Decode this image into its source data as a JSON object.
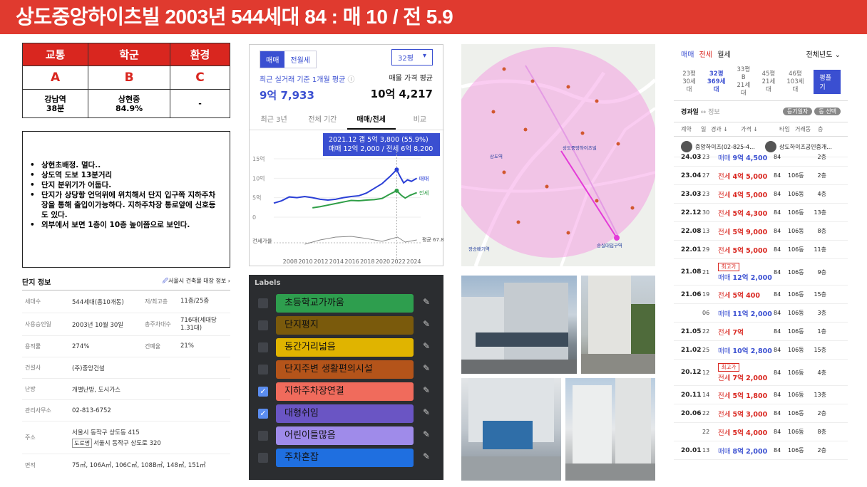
{
  "title": "상도중앙하이츠빌   2003년 544세대   84 : 매 10 / 전 5.9",
  "grades": {
    "headers": [
      "교통",
      "학군",
      "환경"
    ],
    "grades": [
      "A",
      "B",
      "C"
    ],
    "info": [
      [
        "강남역",
        "38분"
      ],
      [
        "상현중",
        "84.9%"
      ],
      [
        "-"
      ]
    ]
  },
  "notes": [
    "상현초배정. 멀다..",
    "상도역 도보 13분거리",
    "단지 분위기가 어둡다.",
    "단지가 상당항 언덕위에 위치해서 단지 입구쪽 지하주차장을 통해 출입이가능하다. 지하주차장 통로앞에 신호등도 있다.",
    "외부에서 보면 1층이 10층 높이쯤으로 보인다."
  ],
  "complex": {
    "title": "단지 정보",
    "link": "서울시 건축물 대장 정보",
    "rows": [
      {
        "k": "세대수",
        "v": "544세대(총10개동)",
        "k2": "저/최고층",
        "v2": "11층/25층"
      },
      {
        "k": "사용승인일",
        "v": "2003년 10월 30일",
        "k2": "총주차대수",
        "v2": "716대(세대당 1.31대)"
      },
      {
        "k": "용적률",
        "v": "274%",
        "k2": "건폐율",
        "v2": "21%"
      },
      {
        "k": "건설사",
        "v": "(주)중앙건설",
        "k2": "",
        "v2": ""
      },
      {
        "k": "난방",
        "v": "개별난방, 도시가스",
        "k2": "",
        "v2": ""
      },
      {
        "k": "관리사무소",
        "v": "02-813-6752",
        "k2": "",
        "v2": ""
      }
    ],
    "address_key": "주소",
    "address1": "서울시 동작구 상도동 415",
    "road_tag": "도로명",
    "address2": "서울시 동작구 상도로 320",
    "area_key": "면적",
    "area": "75㎡, 106A㎡, 106C㎡, 108B㎡, 148㎡, 151㎡"
  },
  "chart_panel": {
    "tab_sale": "매매",
    "tab_rent": "전월세",
    "size": "32평",
    "left_label": "최근 실거래 기준 1개월 평균",
    "left_value": "9억 7,933",
    "right_label": "매물 가격 평균",
    "right_value": "10억 4,217",
    "tabs": [
      "최근 3년",
      "전체 기간",
      "매매/전세",
      "비교"
    ],
    "tooltip1": "2021.12  갭 5억 3,800 (55.9%)",
    "tooltip2": "매매 12억 2,000 / 전세 6억 8,200"
  },
  "chart_data": {
    "type": "line",
    "x_ticks": [
      "2008",
      "2010",
      "2012",
      "2014",
      "2016",
      "2018",
      "2020",
      "2022",
      "2024"
    ],
    "y_ticks": [
      "15억",
      "10억",
      "5억",
      "0"
    ],
    "ylim": [
      0,
      15
    ],
    "bottom_label": "전세가율",
    "series": [
      {
        "name": "매매",
        "x": [
          2006,
          2007,
          2008,
          2009,
          2010,
          2011,
          2012,
          2013,
          2014,
          2015,
          2016,
          2017,
          2018,
          2019,
          2020,
          2021,
          2021.9,
          2022.3,
          2022.8,
          2023.3,
          2023.8,
          2024.5
        ],
        "values": [
          3.6,
          4.2,
          5.2,
          5.0,
          5.3,
          5.0,
          4.6,
          4.4,
          4.6,
          5.0,
          5.3,
          5.5,
          6.2,
          7.4,
          8.6,
          10.4,
          12.2,
          10.6,
          8.8,
          9.6,
          9.2,
          10.0
        ]
      },
      {
        "name": "전세",
        "x": [
          2011,
          2012,
          2013,
          2014,
          2015,
          2016,
          2017,
          2018,
          2019,
          2020,
          2021,
          2021.9,
          2022.5,
          2023,
          2023.6,
          2024.5
        ],
        "values": [
          2.4,
          2.7,
          3.1,
          3.5,
          3.9,
          4.3,
          4.2,
          4.4,
          4.5,
          4.8,
          5.9,
          6.8,
          5.6,
          4.9,
          5.6,
          6.3
        ]
      }
    ],
    "series_labels": [
      "매매",
      "전세"
    ],
    "ratio_label": "평균 67.8%"
  },
  "map": {
    "labels": [
      "상도중앙하이츠빌",
      "상도역",
      "숭실대입구역",
      "장승배기역"
    ]
  },
  "labels_panel": {
    "title": "Labels",
    "items": [
      {
        "text": "초등학교가까움",
        "color": "#2e9e4e",
        "checked": false
      },
      {
        "text": "단지평지",
        "color": "#7a5a0c",
        "checked": false
      },
      {
        "text": "동간거리넓음",
        "color": "#e0b400",
        "checked": false
      },
      {
        "text": "단지주변 생활편의시설",
        "color": "#b4541a",
        "checked": false
      },
      {
        "text": "지하주차장연결",
        "color": "#f06b5c",
        "checked": true
      },
      {
        "text": "대형쉬임",
        "color": "#6a55c4",
        "checked": true
      },
      {
        "text": "어린이들많음",
        "color": "#9f8bea",
        "checked": false
      },
      {
        "text": "주차혼잡",
        "color": "#1f6fe0",
        "checked": false
      }
    ]
  },
  "tx": {
    "tabs": [
      "매매",
      "전세",
      "월세"
    ],
    "year_filter": "전체년도",
    "sizes": [
      {
        "a": "23평",
        "b": "30세대"
      },
      {
        "a": "32평",
        "b": "369세대"
      },
      {
        "a": "33평B",
        "b": "21세대"
      },
      {
        "a": "45평",
        "b": "21세대"
      },
      {
        "a": "46평",
        "b": "103세대"
      }
    ],
    "size_btn": "평플기",
    "sub_left": "경과일",
    "sub_info": "정보",
    "chip1": "등기일자",
    "chip2": "동 선택",
    "headers": [
      "계약",
      "일",
      "경과 ↓",
      "가격 ↓",
      "타입",
      "거래동",
      "층"
    ],
    "agent1": "중앙하이츠(02-825-4...",
    "agent2": "상도하이츠공인중개...",
    "rows": [
      {
        "d": "24.03",
        "dd": "23",
        "kind": "매매",
        "price": "9억 4,500",
        "a": "84",
        "b": "",
        "f": "2층",
        "max": ""
      },
      {
        "d": "23.04",
        "dd": "27",
        "kind": "전세",
        "price": "4억 5,000",
        "a": "84",
        "b": "106동",
        "f": "2층",
        "max": ""
      },
      {
        "d": "23.03",
        "dd": "23",
        "kind": "전세",
        "price": "4억 5,000",
        "a": "84",
        "b": "106동",
        "f": "4층",
        "max": ""
      },
      {
        "d": "22.12",
        "dd": "30",
        "kind": "전세",
        "price": "5억 4,300",
        "a": "84",
        "b": "106동",
        "f": "13층",
        "max": ""
      },
      {
        "d": "22.08",
        "dd": "13",
        "kind": "전세",
        "price": "5억 9,000",
        "a": "84",
        "b": "106동",
        "f": "8층",
        "max": ""
      },
      {
        "d": "22.01",
        "dd": "29",
        "kind": "전세",
        "price": "5억 5,000",
        "a": "84",
        "b": "106동",
        "f": "11층",
        "max": ""
      },
      {
        "d": "21.08",
        "dd": "21",
        "kind": "매매",
        "price": "12억 2,000",
        "a": "84",
        "b": "106동",
        "f": "9층",
        "max": "최고가"
      },
      {
        "d": "21.06",
        "dd": "19",
        "kind": "전세",
        "price": "5억 400",
        "a": "84",
        "b": "106동",
        "f": "15층",
        "max": ""
      },
      {
        "d": "",
        "dd": "06",
        "kind": "매매",
        "price": "11억 2,000",
        "a": "84",
        "b": "106동",
        "f": "3층",
        "max": ""
      },
      {
        "d": "21.05",
        "dd": "22",
        "kind": "전세",
        "price": "7억",
        "a": "84",
        "b": "106동",
        "f": "1층",
        "max": ""
      },
      {
        "d": "21.02",
        "dd": "25",
        "kind": "매매",
        "price": "10억 2,800",
        "a": "84",
        "b": "106동",
        "f": "15층",
        "max": ""
      },
      {
        "d": "20.12",
        "dd": "12",
        "kind": "전세",
        "price": "7억 2,000",
        "a": "84",
        "b": "106동",
        "f": "4층",
        "max": "최고가"
      },
      {
        "d": "20.11",
        "dd": "14",
        "kind": "전세",
        "price": "5억 1,800",
        "a": "84",
        "b": "106동",
        "f": "13층",
        "max": ""
      },
      {
        "d": "20.06",
        "dd": "22",
        "kind": "전세",
        "price": "5억 3,000",
        "a": "84",
        "b": "106동",
        "f": "2층",
        "max": ""
      },
      {
        "d": "",
        "dd": "22",
        "kind": "전세",
        "price": "5억 4,000",
        "a": "84",
        "b": "106동",
        "f": "8층",
        "max": ""
      },
      {
        "d": "20.01",
        "dd": "13",
        "kind": "매매",
        "price": "8억 2,000",
        "a": "84",
        "b": "106동",
        "f": "2층",
        "max": ""
      }
    ]
  }
}
